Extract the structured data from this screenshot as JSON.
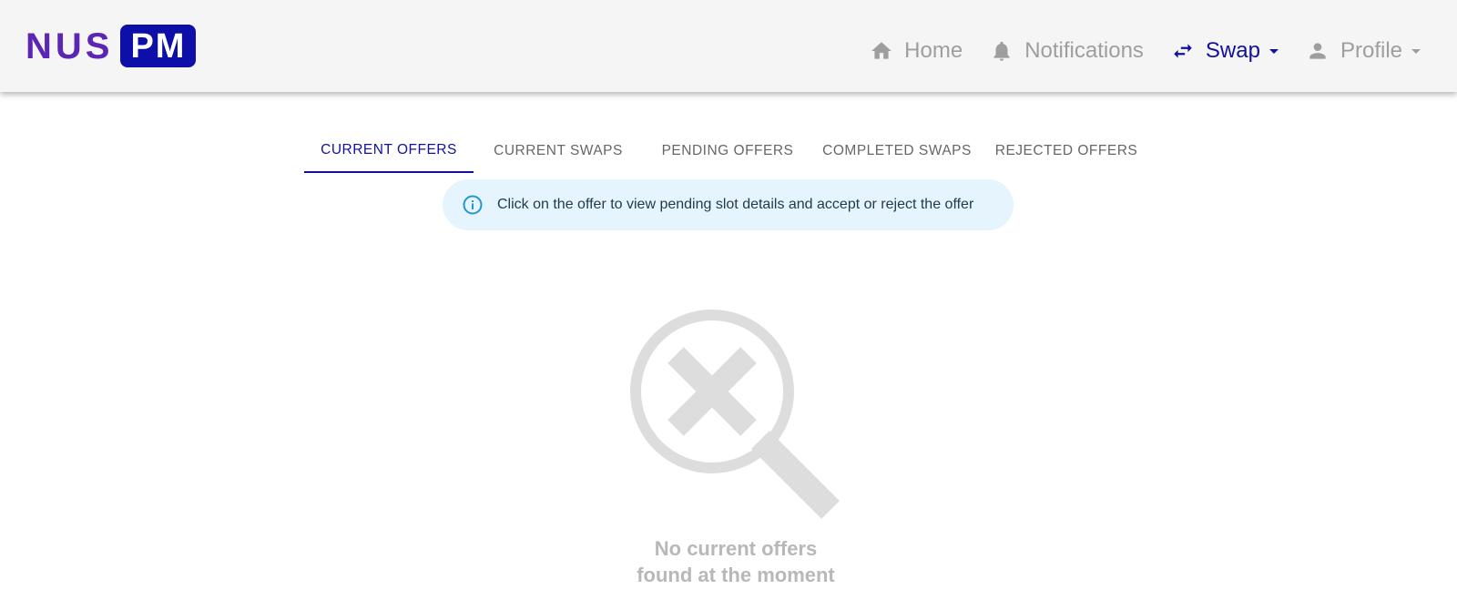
{
  "header": {
    "logo_text": "NUS",
    "logo_badge": "PM",
    "nav": [
      {
        "label": "Home",
        "icon": "home-icon"
      },
      {
        "label": "Notifications",
        "icon": "bell-icon"
      },
      {
        "label": "Swap",
        "icon": "swap-arrows-icon",
        "active": true
      },
      {
        "label": "Profile",
        "icon": "person-icon"
      }
    ]
  },
  "tabs": [
    {
      "label": "CURRENT OFFERS",
      "active": true
    },
    {
      "label": "CURRENT SWAPS"
    },
    {
      "label": "PENDING OFFERS"
    },
    {
      "label": "COMPLETED SWAPS"
    },
    {
      "label": "REJECTED OFFERS"
    }
  ],
  "info_alert": {
    "icon": "info-icon",
    "text": "Click on the offer to view pending slot details and accept or reject the offer"
  },
  "empty_state": {
    "icon": "search-off-icon",
    "line1": "No current offers",
    "line2": "found at the moment"
  },
  "colors": {
    "brand_purple": "#5b26b3",
    "brand_blue": "#11119e",
    "nav_inactive": "#9e9e9e",
    "alert_bg": "#e6f4fd",
    "alert_icon": "#2196d3",
    "empty_gray": "#dddddd"
  }
}
